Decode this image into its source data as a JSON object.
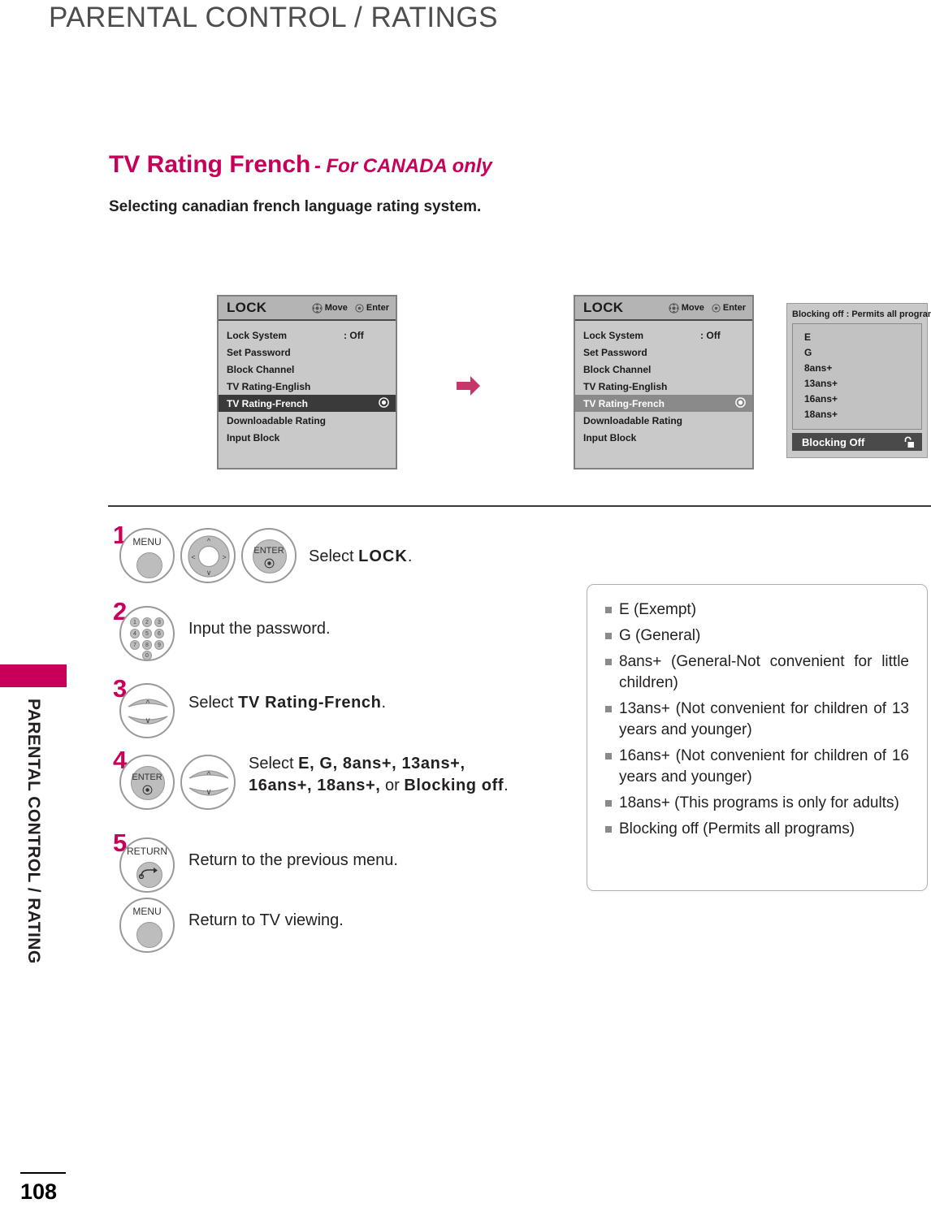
{
  "page": {
    "header_title": "PARENTAL CONTROL / RATINGS",
    "sidebar_label": "PARENTAL CONTROL / RATING",
    "page_number": "108",
    "accent_color": "#c8005a"
  },
  "section": {
    "title_main": "TV Rating French",
    "title_sub": "- For CANADA only",
    "subtitle": "Selecting canadian french language rating system."
  },
  "osd": {
    "title": "LOCK",
    "hint_move": "Move",
    "hint_enter": "Enter",
    "rows": [
      {
        "label": "Lock System",
        "value": ": Off"
      },
      {
        "label": "Set Password",
        "value": ""
      },
      {
        "label": "Block Channel",
        "value": ""
      },
      {
        "label": "TV Rating-English",
        "value": ""
      },
      {
        "label": "TV Rating-French",
        "value": ""
      },
      {
        "label": "Downloadable Rating",
        "value": ""
      },
      {
        "label": "Input Block",
        "value": ""
      }
    ],
    "selected_label": "TV Rating-French"
  },
  "popup": {
    "header": "Blocking off : Permits all programs",
    "items": [
      "E",
      "G",
      "8ans+",
      "13ans+",
      "16ans+",
      "18ans+"
    ],
    "footer_label": "Blocking Off"
  },
  "steps": [
    {
      "number": "1",
      "buttons": [
        "MENU",
        "dpad",
        "ENTER"
      ],
      "text_plain_1": "Select ",
      "text_bold_1": "LOCK",
      "text_plain_2": "."
    },
    {
      "number": "2",
      "buttons": [
        "keypad"
      ],
      "text_plain_1": "Input the password.",
      "keypad_digits": [
        "1",
        "2",
        "3",
        "4",
        "5",
        "6",
        "7",
        "8",
        "9",
        "0"
      ]
    },
    {
      "number": "3",
      "buttons": [
        "updown"
      ],
      "text_plain_1": "Select ",
      "text_bold_1": "TV Rating-French",
      "text_plain_2": "."
    },
    {
      "number": "4",
      "buttons": [
        "ENTER",
        "updown"
      ],
      "line1_plain": "Select ",
      "line1_bold": "E, G, 8ans+, 13ans+,",
      "line2_bold": "16ans+, 18ans+,",
      "line2_plain": " or ",
      "line2_bold2": "Blocking off",
      "line2_end": "."
    },
    {
      "number": "5",
      "buttons": [
        "RETURN"
      ],
      "text_plain_1": "Return to the previous menu."
    },
    {
      "number": "",
      "buttons": [
        "MENU"
      ],
      "text_plain_1": "Return to TV viewing."
    }
  ],
  "button_labels": {
    "menu": "MENU",
    "enter": "ENTER",
    "return": "RETURN"
  },
  "info_box": {
    "items": [
      "E (Exempt)",
      "G (General)",
      "8ans+ (General-Not convenient for little children)",
      "13ans+ (Not convenient for children of 13 years and younger)",
      "16ans+ (Not convenient for children of 16 years and younger)",
      "18ans+ (This programs is only for adults)",
      "Blocking off (Permits all programs)"
    ]
  }
}
